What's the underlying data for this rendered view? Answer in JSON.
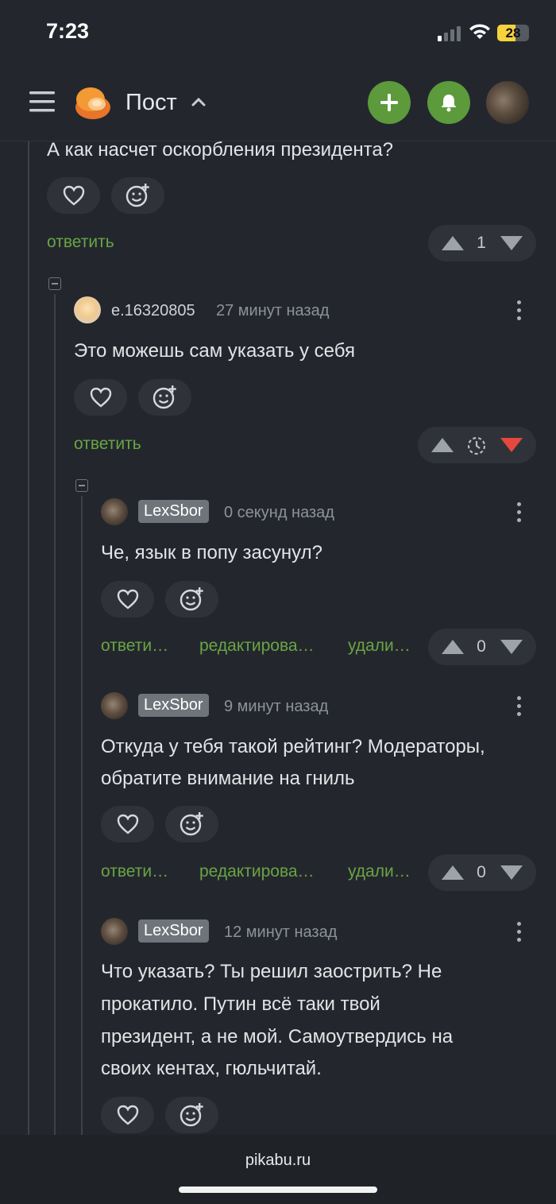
{
  "status": {
    "time": "7:23",
    "battery": "28"
  },
  "header": {
    "title": "Пост",
    "icons": [
      "menu-icon",
      "pikabu-logo",
      "chevron-up-icon",
      "plus-icon",
      "bell-icon"
    ]
  },
  "actions": {
    "reply": "ответить",
    "reply_short": "ответи…",
    "edit": "редактирова…",
    "delete": "удали…"
  },
  "comments": [
    {
      "text": "А как насчет оскорбления президента?",
      "score": "1"
    },
    {
      "user": "e.16320805",
      "time": "27 минут назад",
      "text": "Это можешь сам указать у себя"
    },
    {
      "user": "LexSbor",
      "time": "0 секунд назад",
      "text": "Че, язык в попу засунул?",
      "score": "0"
    },
    {
      "user": "LexSbor",
      "time": "9 минут назад",
      "text_lines": [
        "Откуда у тебя такой рейтинг? Модераторы,",
        "обратите внимание на гниль"
      ],
      "score": "0"
    },
    {
      "user": "LexSbor",
      "time": "12 минут назад",
      "text_lines": [
        "Что указать? Ты решил заострить? Не",
        "прокатило. Путин всё таки твой",
        "президент, а не мой. Самоутвердись на",
        "своих кентах, гюльчитай."
      ]
    }
  ],
  "footer": {
    "url": "pikabu.ru"
  },
  "colors": {
    "background": "#23272d",
    "accent_green": "#5c9a3c",
    "link_green": "#6aa444",
    "downvote_red": "#e5483e"
  }
}
